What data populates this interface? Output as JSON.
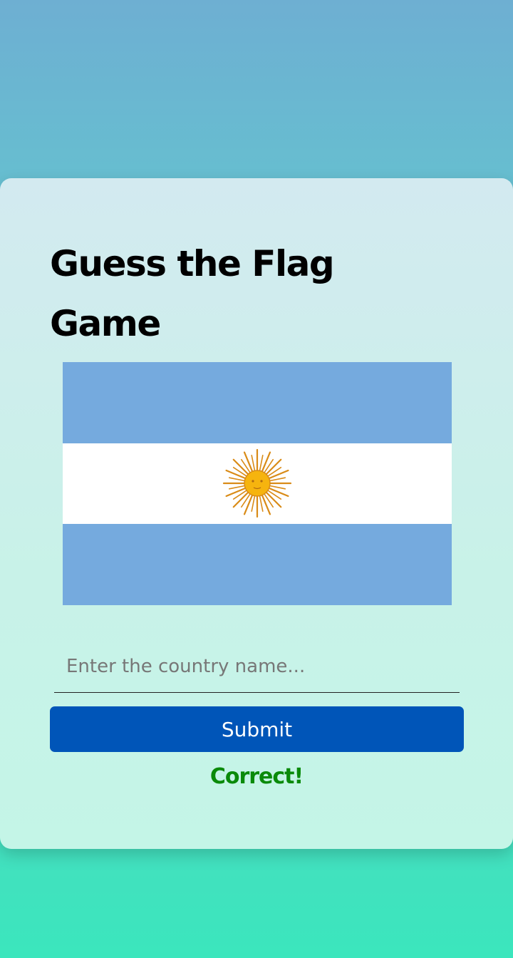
{
  "game": {
    "title": "Guess the Flag Game",
    "flag_icon": "argentina-flag",
    "input_placeholder": "Enter the country name...",
    "input_value": "",
    "submit_label": "Submit",
    "result_text": "Correct!"
  },
  "colors": {
    "flag_blue": "#75aade",
    "flag_white": "#ffffff",
    "sun": "#f6b40e",
    "sun_rays": "#d98b17",
    "button": "#0055b8",
    "result": "#0a8a0a"
  }
}
